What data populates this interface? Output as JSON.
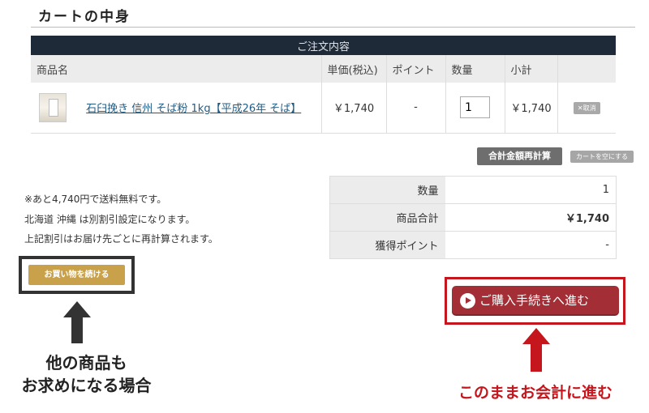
{
  "page": {
    "title": "カートの中身"
  },
  "order_table": {
    "caption": "ご注文内容",
    "headers": [
      "商品名",
      "単価(税込)",
      "ポイント",
      "数量",
      "小計",
      ""
    ],
    "items": [
      {
        "name": "石臼挽き 信州 そば粉 1kg【平成26年 そば】",
        "price": "￥1,740",
        "points": "-",
        "quantity": "1",
        "subtotal": "￥1,740",
        "delete_label": "✕取消"
      }
    ]
  },
  "actions": {
    "recalc_label": "合計金額再計算",
    "empty_cart_label": "カートを空にする",
    "continue_label": "お買い物を続ける",
    "checkout_label": "ご購入手続きへ進む"
  },
  "notes": [
    "※あと4,740円で送料無料です。",
    "北海道 沖縄 は別割引設定になります。",
    "上記割引はお届け先ごとに再計算されます。"
  ],
  "summary": {
    "quantity_label": "数量",
    "quantity_value": "1",
    "total_label": "商品合計",
    "total_value": "￥1,740",
    "points_label": "獲得ポイント",
    "points_value": "-"
  },
  "annotations": {
    "left_line1": "他の商品も",
    "left_line2": "お求めになる場合",
    "right": "このままお会計に進む"
  },
  "colors": {
    "header_bg": "#1e2a38",
    "continue_btn": "#c9a14a",
    "checkout_btn": "#a32e36",
    "highlight_red": "#c4161c"
  }
}
